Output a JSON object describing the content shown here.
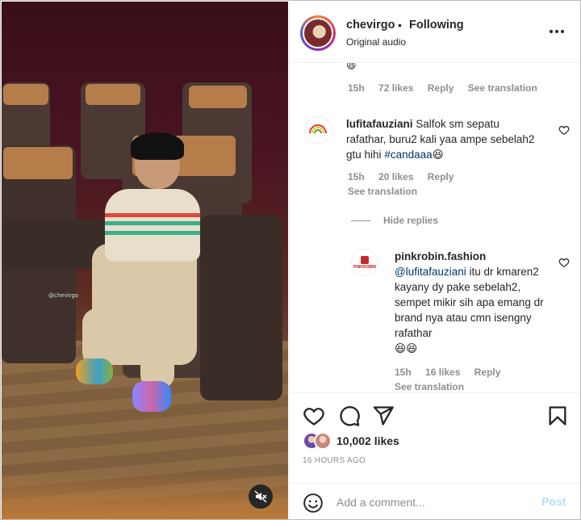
{
  "header": {
    "username": "chevirgo",
    "separator": "•",
    "follow_status": "Following",
    "audio": "Original audio",
    "more_icon": "more-horizontal-icon"
  },
  "media": {
    "watermark": "@chevirgo",
    "mute_icon": "speaker-muted-icon"
  },
  "comments": {
    "top_partial": {
      "emoji": "😆",
      "time": "15h",
      "likes": "72 likes",
      "reply": "Reply",
      "see_translation": "See translation"
    },
    "items": [
      {
        "username": "lufitafauziani",
        "text": "Salfok sm sepatu rafathar, buru2 kali yaa ampe sebelah2 gtu hihi",
        "hashtag": "#candaaa",
        "emoji": "😆",
        "time": "15h",
        "likes": "20 likes",
        "reply": "Reply",
        "see_translation": "See translation"
      }
    ],
    "hide_replies": "Hide replies",
    "replies": [
      {
        "username": "pinkrobin.fashion",
        "avatar_text": "PINKROBIN",
        "mention": "@lufitafauziani",
        "text": "itu dr kmaren2 kayany dy pake sebelah2, sempet mikir sih apa emang dr brand nya atau cmn isengny rafathar",
        "emoji": "😆😆",
        "time": "15h",
        "likes": "16 likes",
        "reply": "Reply",
        "see_translation": "See translation"
      }
    ]
  },
  "actions": {
    "like_icon": "heart-icon",
    "comment_icon": "comment-icon",
    "share_icon": "paper-plane-icon",
    "save_icon": "bookmark-icon",
    "likes_count": "10,002 likes",
    "timestamp": "16 HOURS AGO"
  },
  "composer": {
    "emoji_icon": "smiley-icon",
    "placeholder": "Add a comment...",
    "post_label": "Post"
  },
  "colors": {
    "text": "#262626",
    "secondary": "#8e8e8e",
    "link": "#00376b",
    "post_disabled": "#b2dffc"
  }
}
